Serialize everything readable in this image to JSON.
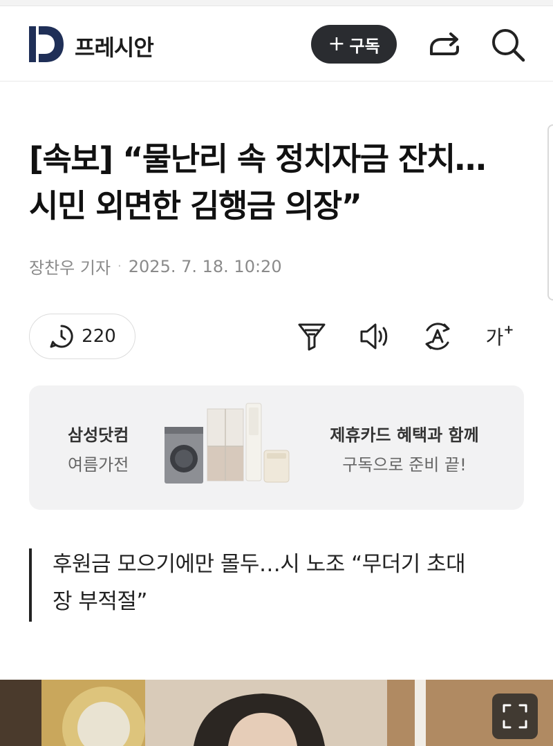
{
  "header": {
    "logo_letter": "D",
    "brand": "프레시안",
    "subscribe_plus": "+",
    "subscribe_label": "구독",
    "share_icon": "share-arrow-icon",
    "search_icon": "search-icon"
  },
  "article": {
    "headline_line1": "[속보] “물난리 속 정치자금 잔치…",
    "headline_line2": "시민 외면한 김행금 의장”",
    "author": "장찬우 기자",
    "separator": "·",
    "timestamp": "2025. 7. 18. 10:20",
    "comment_count": "220",
    "subheadline_line1": "후원금 모으기에만 몰두…시 노조 “무더기 초대",
    "subheadline_line2": "장 부적절”"
  },
  "tools": {
    "font_size_glyph": "가",
    "font_size_plus": "+"
  },
  "ad": {
    "left_line1": "삼성닷컴",
    "left_line2": "여름가전",
    "right_line1": "제휴카드 혜택과 함께",
    "right_line2": "구독으로 준비 끝!"
  },
  "colors": {
    "brand_navy": "#1f2f57",
    "subscribe_bg": "#2a2c30",
    "ad_bg": "#f2f2f3",
    "meta_gray": "#8a8a8a"
  }
}
